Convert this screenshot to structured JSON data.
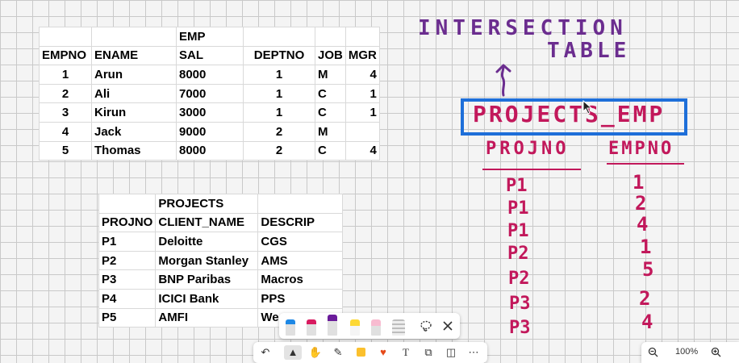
{
  "emp_table": {
    "title": "EMP",
    "headers": [
      "EMPNO",
      "ENAME",
      "SAL",
      "DEPTNO",
      "JOB",
      "MGR"
    ],
    "rows": [
      [
        "1",
        "Arun",
        "8000",
        "1",
        "M",
        "4"
      ],
      [
        "2",
        "Ali",
        "7000",
        "1",
        "C",
        "1"
      ],
      [
        "3",
        "Kirun",
        "3000",
        "1",
        "C",
        "1"
      ],
      [
        "4",
        "Jack",
        "9000",
        "2",
        "M",
        ""
      ],
      [
        "5",
        "Thomas",
        "8000",
        "2",
        "C",
        "4"
      ]
    ]
  },
  "projects_table": {
    "title": "PROJECTS",
    "headers": [
      "PROJNO",
      "CLIENT_NAME",
      "DESCRIP"
    ],
    "rows": [
      [
        "P1",
        "Deloitte",
        "CGS"
      ],
      [
        "P2",
        "Morgan Stanley",
        "AMS"
      ],
      [
        "P3",
        "BNP Paribas",
        "Macros"
      ],
      [
        "P4",
        "ICICI Bank",
        "PPS"
      ],
      [
        "P5",
        "AMFI",
        "We"
      ]
    ]
  },
  "handwriting": {
    "title_line1": "INTERSECTION",
    "title_line2": "TABLE",
    "box_label": "PROJECTS_EMP",
    "col1_header": "PROJNO",
    "col2_header": "EMPNO",
    "projno_values": [
      "P1",
      "P1",
      "P1",
      "P2",
      "P2",
      "P3",
      "P3"
    ],
    "empno_values": [
      "1",
      "2",
      "4",
      "1",
      "5",
      "2",
      "4"
    ]
  },
  "colors": {
    "purple_ink": "#6b2d8f",
    "magenta_ink": "#c2185b",
    "box_border": "#1e6fd9"
  },
  "pen_tray": {
    "pens": [
      "blue-pen",
      "red-pen",
      "purple-pen",
      "yellow-highlighter",
      "pink-eraser",
      "ruler"
    ],
    "lasso_icon": "lasso-icon",
    "close_icon": "close-icon"
  },
  "toolbar": {
    "tools": [
      "undo-icon",
      "select-icon",
      "hand-icon",
      "pen-icon",
      "sticky-note-icon",
      "reaction-icon",
      "text-icon",
      "shapes-icon",
      "frame-icon",
      "more-icon"
    ]
  },
  "zoom": {
    "level": "100%"
  }
}
